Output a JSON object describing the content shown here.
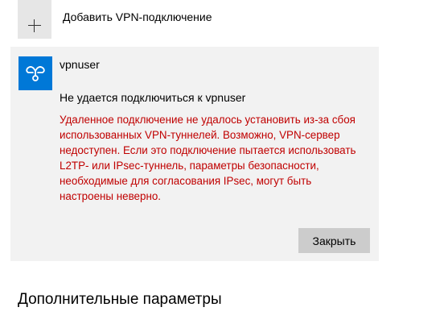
{
  "add_vpn": {
    "label": "Добавить VPN-подключение",
    "icon": "plus-icon"
  },
  "connection": {
    "name": "vpnuser",
    "icon": "vpn-connection-icon",
    "icon_color": "#0078d7",
    "error_title": "Не удается подключиться к vpnuser",
    "error_lines": [
      "Удаленное подключение не удалось установить из-за сбоя",
      "использованных VPN-туннелей. Возможно, VPN-сервер",
      "недоступен. Если это подключение пытается использовать",
      "L2TP- или IPsec-туннель, параметры безопасности,",
      "необходимые для согласования IPsec, могут быть",
      "настроены неверно."
    ],
    "error_color": "#c00000",
    "close_label": "Закрыть"
  },
  "advanced": {
    "heading": "Дополнительные параметры"
  }
}
